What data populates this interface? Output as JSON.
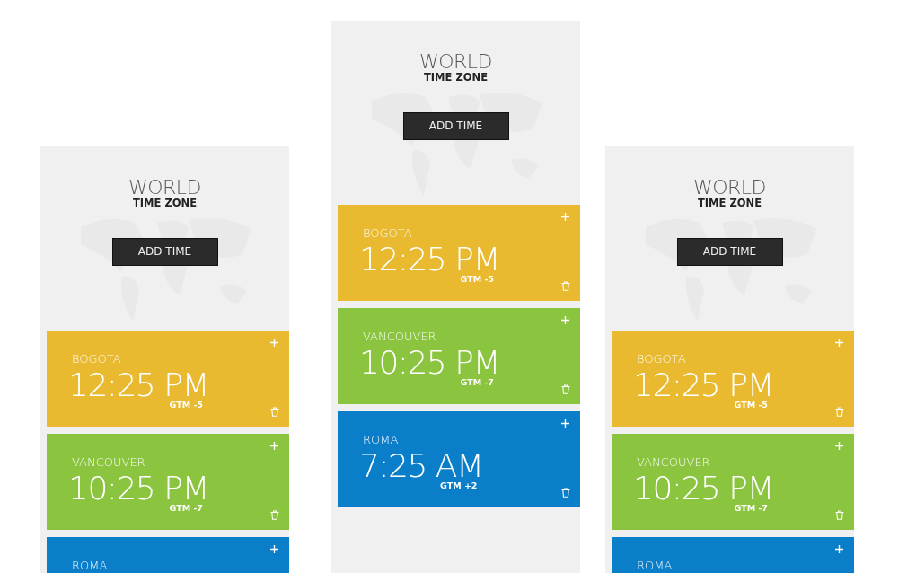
{
  "panels": [
    {
      "title": "WORLD",
      "subtitle": "TIME ZONE",
      "button": "ADD TIME",
      "clocks": [
        {
          "city": "BOGOTA",
          "time": "12:25 PM",
          "offset": "GTM -5",
          "color": "#e9b92f"
        },
        {
          "city": "VANCOUVER",
          "time": "10:25 PM",
          "offset": "GTM -7",
          "color": "#8bc43f"
        },
        {
          "city": "ROMA",
          "color": "#0b7ec9"
        }
      ]
    },
    {
      "title": "WORLD",
      "subtitle": "TIME ZONE",
      "button": "ADD TIME",
      "clocks": [
        {
          "city": "BOGOTA",
          "time": "12:25 PM",
          "offset": "GTM -5",
          "color": "#e9b92f"
        },
        {
          "city": "VANCOUVER",
          "time": "10:25 PM",
          "offset": "GTM -7",
          "color": "#8bc43f"
        },
        {
          "city": "ROMA",
          "time": "7:25 AM",
          "offset": "GTM +2",
          "color": "#0b7ec9"
        }
      ]
    },
    {
      "title": "WORLD",
      "subtitle": "TIME ZONE",
      "button": "ADD TIME",
      "clocks": [
        {
          "city": "BOGOTA",
          "time": "12:25 PM",
          "offset": "GTM -5",
          "color": "#e9b92f"
        },
        {
          "city": "VANCOUVER",
          "time": "10:25 PM",
          "offset": "GTM -7",
          "color": "#8bc43f"
        },
        {
          "city": "ROMA",
          "color": "#0b7ec9"
        }
      ]
    }
  ]
}
